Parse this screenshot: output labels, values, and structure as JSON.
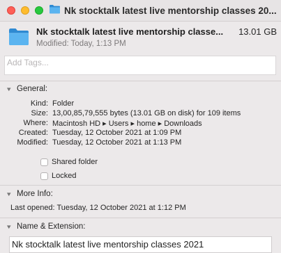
{
  "window": {
    "title": "Nk stocktalk latest live mentorship classes 20..."
  },
  "header": {
    "name": "Nk stocktalk latest live mentorship classe...",
    "size": "13.01 GB",
    "modified": "Modified: Today, 1:13 PM",
    "icon": "folder-icon",
    "folder_color": "#3d9fe0"
  },
  "tags": {
    "placeholder": "Add Tags..."
  },
  "general": {
    "label": "General:",
    "rows": [
      {
        "key": "Kind:",
        "value": "Folder"
      },
      {
        "key": "Size:",
        "value": "13,00,85,79,555 bytes (13.01 GB on disk) for 109 items"
      },
      {
        "key": "Where:",
        "value": "Macintosh HD ▸ Users ▸ home ▸ Downloads"
      },
      {
        "key": "Created:",
        "value": "Tuesday, 12 October 2021 at 1:09 PM"
      },
      {
        "key": "Modified:",
        "value": "Tuesday, 12 October 2021 at 1:13 PM"
      }
    ],
    "shared_folder_label": "Shared folder",
    "locked_label": "Locked"
  },
  "more_info": {
    "label": "More Info:",
    "last_opened": "Last opened: Tuesday, 12 October 2021 at 1:12 PM"
  },
  "name_extension": {
    "label": "Name & Extension:",
    "value": "Nk stocktalk latest live mentorship classes 2021"
  }
}
